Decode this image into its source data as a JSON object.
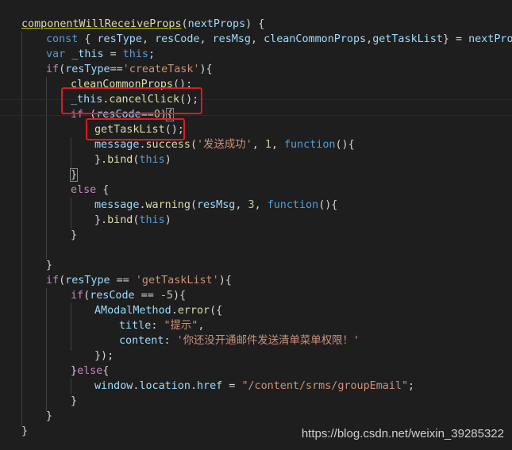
{
  "code": {
    "l1": [
      "componentWillReceiveProps",
      "(",
      "nextProps",
      ") {"
    ],
    "l2": [
      "const",
      " { ",
      "resType",
      ", ",
      "resCode",
      ", ",
      "resMsg",
      ", ",
      "cleanCommonProps",
      ",",
      "getTaskList",
      "} = ",
      "nextProps",
      ";"
    ],
    "l3": [
      "var",
      " ",
      "_this",
      " = ",
      "this",
      ";"
    ],
    "l4": [
      "if",
      "(",
      "resType",
      "==",
      "'createTask'",
      "){"
    ],
    "l5": [
      "cleanCommonProps",
      "();"
    ],
    "l6": [
      "_this",
      ".",
      "cancelClick",
      "();"
    ],
    "l7": [
      "if",
      " (",
      "resCode",
      "==",
      "0",
      ")",
      "{"
    ],
    "l8": [
      "getTaskList",
      "();"
    ],
    "l9": [
      "message",
      ".",
      "success",
      "(",
      "'发送成功'",
      ", ",
      "1",
      ", ",
      "function",
      "(){"
    ],
    "l10": [
      "}.",
      "bind",
      "(",
      "this",
      ")"
    ],
    "l11": [
      "}"
    ],
    "l12": [
      "else",
      " {"
    ],
    "l13": [
      "message",
      ".",
      "warning",
      "(",
      "resMsg",
      ", ",
      "3",
      ", ",
      "function",
      "(){"
    ],
    "l14": [
      "}.",
      "bind",
      "(",
      "this",
      ")"
    ],
    "l15": [
      "}"
    ],
    "l16": [
      "}"
    ],
    "l17": [
      "if",
      "(",
      "resType",
      " == ",
      "'getTaskList'",
      "){"
    ],
    "l18": [
      "if",
      "(",
      "resCode",
      " == ",
      "-5",
      "){"
    ],
    "l19": [
      "AModalMethod",
      ".",
      "error",
      "({"
    ],
    "l20": [
      "title",
      ": ",
      "\"提示\"",
      ","
    ],
    "l21": [
      "content",
      ": ",
      "'你还没开通邮件发送清单菜单权限！'"
    ],
    "l22": [
      "});"
    ],
    "l23": [
      "}",
      "else",
      "{"
    ],
    "l24": [
      "window",
      ".",
      "location",
      ".",
      "href",
      " = ",
      "\"/content/srms/groupEmail\"",
      ";"
    ],
    "l25": [
      "}"
    ],
    "l26": [
      "}"
    ],
    "l27": [
      "}"
    ]
  },
  "watermark": "https://blog.csdn.net/weixin_39285322",
  "colors": {
    "background": "#1e1e1e",
    "keyword": "#569cd6",
    "control": "#c586c0",
    "function": "#dcdcaa",
    "variable": "#9cdcfe",
    "string": "#ce9178",
    "number": "#b5cea8",
    "highlight_box": "#e0191f"
  }
}
